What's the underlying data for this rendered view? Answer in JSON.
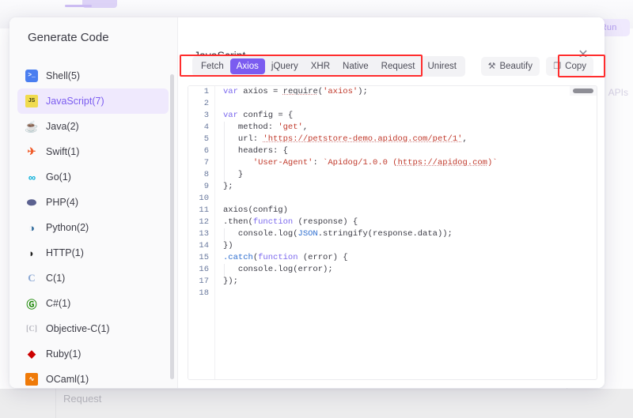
{
  "background": {
    "run_button": "Run",
    "apis_label": "APIs",
    "request_label": "Request"
  },
  "modal": {
    "sidebar": {
      "title": "Generate Code",
      "items": [
        {
          "label": "Shell(5)",
          "icon": "shell-icon",
          "glyph": "⌫",
          "cls": "ic-shell",
          "text": "&gt;_",
          "selected": false
        },
        {
          "label": "JavaScript(7)",
          "icon": "javascript-icon",
          "glyph": "JS",
          "cls": "ic-js",
          "text": "JS",
          "selected": true
        },
        {
          "label": "Java(2)",
          "icon": "java-icon",
          "glyph": "☕",
          "cls": "ic-java",
          "text": "☕",
          "selected": false
        },
        {
          "label": "Swift(1)",
          "icon": "swift-icon",
          "glyph": "➤",
          "cls": "ic-swift",
          "text": "✈",
          "selected": false
        },
        {
          "label": "Go(1)",
          "icon": "go-icon",
          "glyph": "GO",
          "cls": "ic-go",
          "text": "∞",
          "selected": false
        },
        {
          "label": "PHP(4)",
          "icon": "php-icon",
          "glyph": "php",
          "cls": "ic-php",
          "text": "⬬",
          "selected": false
        },
        {
          "label": "Python(2)",
          "icon": "python-icon",
          "glyph": "ὀD",
          "cls": "ic-python",
          "text": "◑",
          "selected": false
        },
        {
          "label": "HTTP(1)",
          "icon": "http-icon",
          "glyph": "H",
          "cls": "ic-http",
          "text": "◗",
          "selected": false
        },
        {
          "label": "C(1)",
          "icon": "c-icon",
          "glyph": "C",
          "cls": "ic-c",
          "text": "C",
          "selected": false
        },
        {
          "label": "C#(1)",
          "icon": "csharp-icon",
          "glyph": "C#",
          "cls": "ic-csharp",
          "text": "Ⓖ",
          "selected": false
        },
        {
          "label": "Objective-C(1)",
          "icon": "objective-c-icon",
          "glyph": "[C]",
          "cls": "ic-objc",
          "text": "[C]",
          "selected": false
        },
        {
          "label": "Ruby(1)",
          "icon": "ruby-icon",
          "glyph": "◆",
          "cls": "ic-ruby",
          "text": "◆",
          "selected": false
        },
        {
          "label": "OCaml(1)",
          "icon": "ocaml-icon",
          "glyph": "∿",
          "cls": "ic-ocaml",
          "text": "∿",
          "selected": false
        }
      ]
    },
    "panel": {
      "title": "JavaScript",
      "close_icon": "✕",
      "tabs": [
        {
          "label": "Fetch",
          "active": false
        },
        {
          "label": "Axios",
          "active": true
        },
        {
          "label": "jQuery",
          "active": false
        },
        {
          "label": "XHR",
          "active": false
        },
        {
          "label": "Native",
          "active": false
        },
        {
          "label": "Request",
          "active": false
        },
        {
          "label": "Unirest",
          "active": false
        }
      ],
      "beautify_label": "Beautify",
      "beautify_icon": "⚒",
      "copy_label": "Copy",
      "copy_icon": "❐",
      "accent_color": "#7b5cf0",
      "annotation_color": "#ff2d2d"
    },
    "code": {
      "language": "JavaScript",
      "variant": "Axios",
      "line_count": 18,
      "lines": [
        {
          "n": 1,
          "tokens": [
            {
              "t": "var ",
              "c": "tk-kw"
            },
            {
              "t": "axios = "
            },
            {
              "t": "require",
              "c": "spell"
            },
            {
              "t": "("
            },
            {
              "t": "'axios'",
              "c": "tk-str"
            },
            {
              "t": ");"
            }
          ]
        },
        {
          "n": 2,
          "tokens": []
        },
        {
          "n": 3,
          "tokens": [
            {
              "t": "var ",
              "c": "tk-kw"
            },
            {
              "t": "config = {"
            }
          ]
        },
        {
          "n": 4,
          "tokens": [
            {
              "t": "   method: "
            },
            {
              "t": "'get'",
              "c": "tk-str"
            },
            {
              "t": ","
            }
          ]
        },
        {
          "n": 5,
          "tokens": [
            {
              "t": "   url: "
            },
            {
              "t": "'https://petstore-demo.apidog.com/pet/1'",
              "c": "tk-str spell"
            },
            {
              "t": ","
            }
          ]
        },
        {
          "n": 6,
          "tokens": [
            {
              "t": "   headers: {"
            }
          ]
        },
        {
          "n": 7,
          "tokens": [
            {
              "t": "      "
            },
            {
              "t": "'User-Agent'",
              "c": "tk-str"
            },
            {
              "t": ": "
            },
            {
              "t": "`Apidog/1.0.0 (",
              "c": "tk-str"
            },
            {
              "t": "https://apidog.com",
              "c": "tk-str spell"
            },
            {
              "t": ")`",
              "c": "tk-str"
            }
          ]
        },
        {
          "n": 8,
          "tokens": [
            {
              "t": "   }"
            }
          ]
        },
        {
          "n": 9,
          "tokens": [
            {
              "t": "};"
            }
          ]
        },
        {
          "n": 10,
          "tokens": []
        },
        {
          "n": 11,
          "tokens": [
            {
              "t": "axios(config)"
            }
          ]
        },
        {
          "n": 12,
          "tokens": [
            {
              "t": ".then("
            },
            {
              "t": "function",
              "c": "tk-kw"
            },
            {
              "t": " (response) {"
            }
          ]
        },
        {
          "n": 13,
          "tokens": [
            {
              "t": "   console.log("
            },
            {
              "t": "JSON",
              "c": "tk-cls"
            },
            {
              "t": ".stringify(response.data));"
            }
          ]
        },
        {
          "n": 14,
          "tokens": [
            {
              "t": "})"
            }
          ]
        },
        {
          "n": 15,
          "tokens": [
            {
              "t": ".catch",
              "c": "tk-fn"
            },
            {
              "t": "("
            },
            {
              "t": "function",
              "c": "tk-kw"
            },
            {
              "t": " (error) {"
            }
          ]
        },
        {
          "n": 16,
          "tokens": [
            {
              "t": "   console.log(error);"
            }
          ]
        },
        {
          "n": 17,
          "tokens": [
            {
              "t": "});"
            }
          ]
        },
        {
          "n": 18,
          "tokens": []
        }
      ]
    }
  }
}
